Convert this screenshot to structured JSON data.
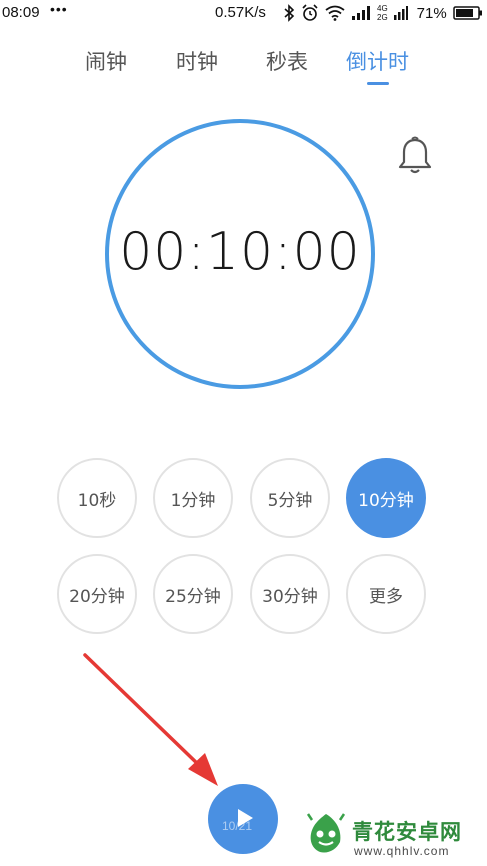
{
  "status_bar": {
    "time": "08:09",
    "dots": "•••",
    "speed": "0.57K/s",
    "network_labels": [
      "4G",
      "2G"
    ],
    "battery_percent": "71%",
    "icons": [
      "bluetooth-icon",
      "alarm-clock-icon",
      "wifi-icon",
      "signal-icon",
      "battery-icon"
    ]
  },
  "tabs": [
    {
      "label": "闹钟",
      "active": false
    },
    {
      "label": "时钟",
      "active": false
    },
    {
      "label": "秒表",
      "active": false
    },
    {
      "label": "倒计时",
      "active": true
    }
  ],
  "timer": {
    "display": "00:10:00"
  },
  "presets": [
    {
      "label": "10秒",
      "selected": false
    },
    {
      "label": "1分钟",
      "selected": false
    },
    {
      "label": "5分钟",
      "selected": false
    },
    {
      "label": "10分钟",
      "selected": true
    },
    {
      "label": "20分钟",
      "selected": false
    },
    {
      "label": "25分钟",
      "selected": false
    },
    {
      "label": "30分钟",
      "selected": false
    },
    {
      "label": "更多",
      "selected": false
    }
  ],
  "play_overlay_text": "10/21",
  "watermark": {
    "title": "青花安卓网",
    "url": "www.qhhlv.com"
  },
  "colors": {
    "accent": "#4a90e2",
    "ring": "#4a9be3",
    "arrow": "#e53935",
    "watermark_green": "#2f8a3c"
  }
}
